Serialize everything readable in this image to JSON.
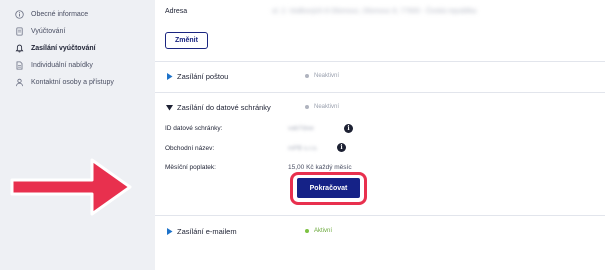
{
  "sidebar": {
    "items": [
      {
        "label": "Obecné informace",
        "icon": "info-circle-icon",
        "active": false
      },
      {
        "label": "Vyúčtování",
        "icon": "document-icon",
        "active": false
      },
      {
        "label": "Zasílání vyúčtování",
        "icon": "bell-icon",
        "active": true
      },
      {
        "label": "Individuální nabídky",
        "icon": "file-icon",
        "active": false
      },
      {
        "label": "Kontaktní osoby a přístupy",
        "icon": "person-icon",
        "active": false
      }
    ]
  },
  "address": {
    "label": "Adresa",
    "value": "ul. 2. Vodkových 8 Olomouc, Olomouc 8, 77900 - Česká republika",
    "change_label": "Změnit"
  },
  "postal": {
    "title": "Zasílání poštou",
    "status": "Neaktivní"
  },
  "databox": {
    "title": "Zasílání do datové schránky",
    "status": "Neaktivní",
    "fields": [
      {
        "label": "ID datové schránky:",
        "value": "vab7dxw"
      },
      {
        "label": "Obchodní název:",
        "value": "mPB s.r.o."
      },
      {
        "label": "Měsíční poplatek:",
        "value": "15,00 Kč každý měsíc"
      }
    ],
    "continue_label": "Pokračovat"
  },
  "email": {
    "title": "Zasílání e-mailem",
    "status": "Aktivní"
  },
  "colors": {
    "primary": "#152287",
    "highlight": "#e8304e",
    "active_status": "#7dc242",
    "inactive_status": "#b0b4bf"
  }
}
